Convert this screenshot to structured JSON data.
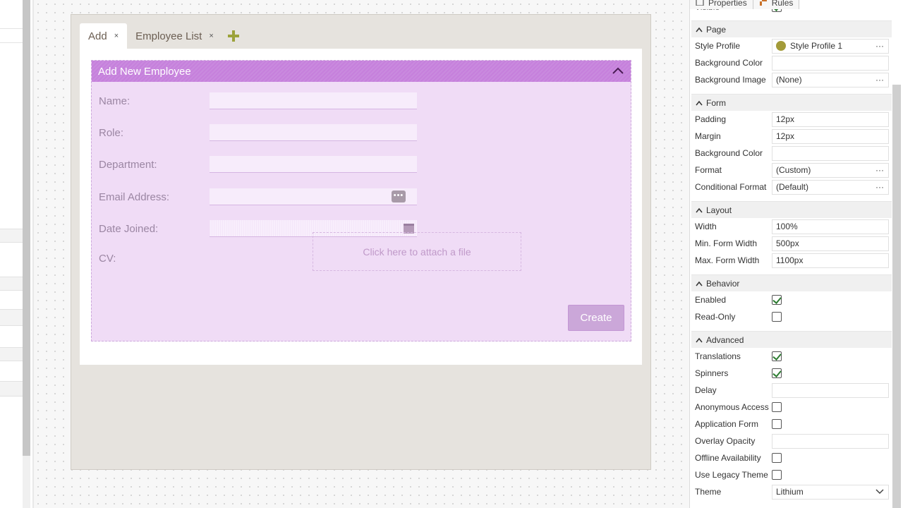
{
  "designer": {
    "tabs": [
      {
        "label": "Add",
        "active": true,
        "close": "×"
      },
      {
        "label": "Employee List",
        "active": false,
        "close": "×"
      }
    ],
    "panel": {
      "title": "Add New Employee",
      "fields": [
        {
          "label": "Name:"
        },
        {
          "label": "Role:"
        },
        {
          "label": "Department:"
        },
        {
          "label": "Email Address:"
        },
        {
          "label": "Date Joined:"
        },
        {
          "label": "CV:"
        }
      ],
      "ellipsis": "•••",
      "file_prompt": "Click here to attach a file",
      "create_label": "Create"
    }
  },
  "properties_panel": {
    "tabs": [
      {
        "label": "Properties"
      },
      {
        "label": "Rules"
      }
    ],
    "top_partial_label": "Visible",
    "sections": {
      "page": {
        "title": "Page",
        "style_profile": {
          "label": "Style Profile",
          "value": "Style Profile 1"
        },
        "background_color": {
          "label": "Background Color",
          "value": ""
        },
        "background_image": {
          "label": "Background Image",
          "value": "(None)"
        }
      },
      "form": {
        "title": "Form",
        "padding": {
          "label": "Padding",
          "value": "12px"
        },
        "margin": {
          "label": "Margin",
          "value": "12px"
        },
        "background_color": {
          "label": "Background Color",
          "value": ""
        },
        "format": {
          "label": "Format",
          "value": "(Custom)"
        },
        "conditional_format": {
          "label": "Conditional Format",
          "value": "(Default)"
        }
      },
      "layout": {
        "title": "Layout",
        "width": {
          "label": "Width",
          "value": "100%"
        },
        "min_width": {
          "label": "Min. Form Width",
          "value": "500px"
        },
        "max_width": {
          "label": "Max. Form Width",
          "value": "1100px"
        }
      },
      "behavior": {
        "title": "Behavior",
        "enabled": {
          "label": "Enabled",
          "checked": true
        },
        "read_only": {
          "label": "Read-Only",
          "checked": false
        }
      },
      "advanced": {
        "title": "Advanced",
        "translations": {
          "label": "Translations",
          "checked": true
        },
        "spinners": {
          "label": "Spinners",
          "checked": true
        },
        "delay": {
          "label": "Delay",
          "value": ""
        },
        "anonymous_access": {
          "label": "Anonymous Access",
          "checked": false
        },
        "application_form": {
          "label": "Application Form",
          "checked": false
        },
        "overlay_opacity": {
          "label": "Overlay Opacity",
          "value": ""
        },
        "offline_availability": {
          "label": "Offline Availability",
          "checked": false
        },
        "use_legacy_theme": {
          "label": "Use Legacy Theme",
          "checked": false
        },
        "theme": {
          "label": "Theme",
          "value": "Lithium"
        }
      }
    },
    "dots": "···"
  },
  "colors": {
    "panel_header": "#c680dc",
    "panel_body": "#f0dcf6",
    "add_tab_icon": "#9ca23a",
    "checkbox_check": "#2e7d32"
  }
}
